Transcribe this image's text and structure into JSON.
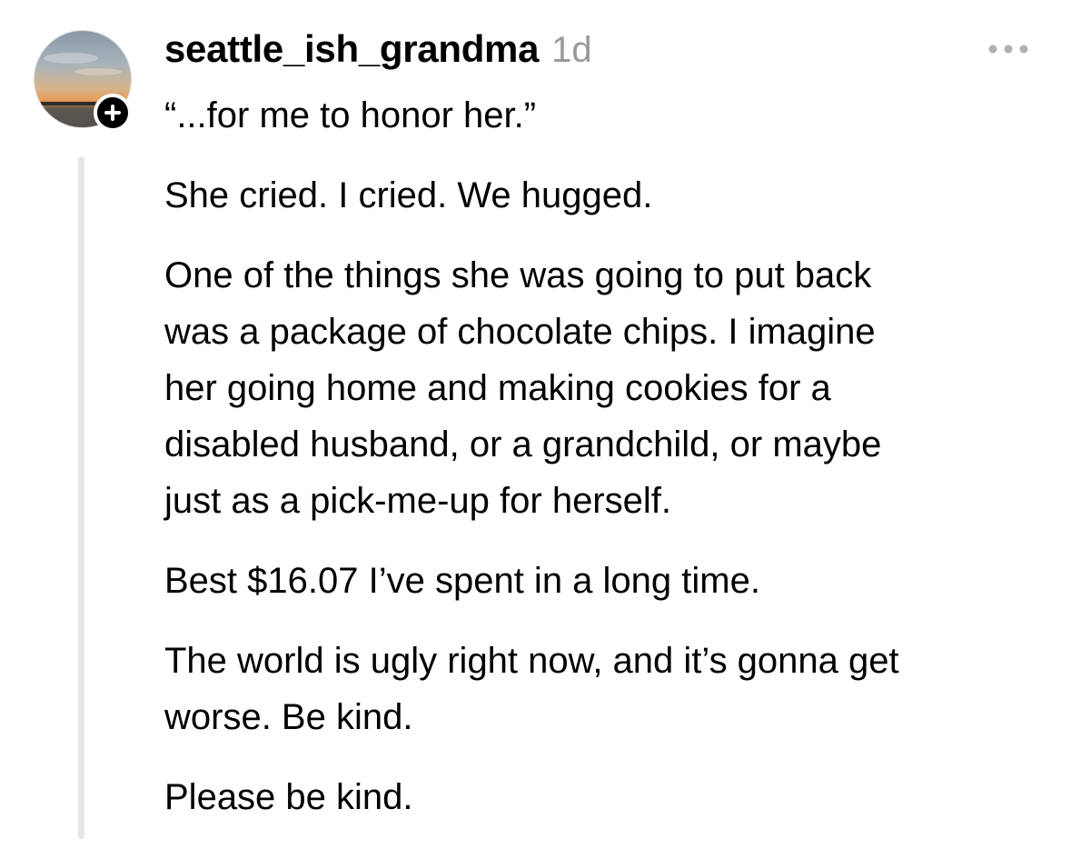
{
  "post": {
    "username": "seattle_ish_grandma",
    "timestamp": "1d",
    "avatar_icon": "sunset-avatar-image",
    "follow_icon": "plus-icon",
    "more_icon": "more-horizontal-icon",
    "paragraphs": [
      "“...for me to honor her.”",
      "She cried. I cried. We hugged.",
      "One of the things she was going to put back\nwas a package of chocolate chips. I imagine\nher going home and making cookies for a\ndisabled husband, or a grandchild, or maybe\njust as a pick-me-up for herself.",
      "Best $16.07 I’ve spent in a long time.",
      "The world is ugly right now, and it’s gonna get\nworse. Be kind.",
      "Please be kind."
    ]
  },
  "colors": {
    "text": "#000000",
    "muted": "#999999",
    "thread_line": "#e6e6e6",
    "badge": "#000000"
  }
}
